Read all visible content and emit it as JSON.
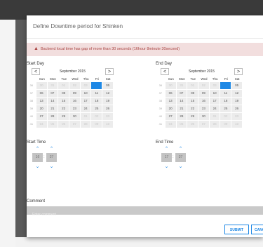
{
  "modal": {
    "title": "Define Downtime period for Shinken",
    "alert": "Backend local time has gap of more than 30 seconds (16hour 8minute 30second)",
    "alert_icon": "warning-icon"
  },
  "start_day": {
    "label": "Start Day",
    "month": "September 2015",
    "prev": "<",
    "next": ">",
    "weekdays": [
      "Sun",
      "Mon",
      "Tue",
      "Wed",
      "Thu",
      "Fri",
      "Sat"
    ],
    "weeks": [
      {
        "wk": "36",
        "days": [
          "30",
          "31",
          "01",
          "02",
          "03",
          "04",
          "05"
        ]
      },
      {
        "wk": "37",
        "days": [
          "06",
          "07",
          "08",
          "09",
          "10",
          "11",
          "12"
        ]
      },
      {
        "wk": "38",
        "days": [
          "13",
          "14",
          "15",
          "16",
          "17",
          "18",
          "19"
        ]
      },
      {
        "wk": "39",
        "days": [
          "20",
          "21",
          "22",
          "23",
          "24",
          "25",
          "26"
        ]
      },
      {
        "wk": "40",
        "days": [
          "27",
          "28",
          "29",
          "30",
          "01",
          "02",
          "03"
        ]
      },
      {
        "wk": "41",
        "days": [
          "04",
          "05",
          "06",
          "07",
          "08",
          "09",
          "10"
        ]
      }
    ]
  },
  "end_day": {
    "label": "End Day",
    "month": "September 2015",
    "prev": "<",
    "next": ">",
    "weekdays": [
      "Sun",
      "Mon",
      "Tue",
      "Wed",
      "Thu",
      "Fri",
      "Sat"
    ],
    "weeks": [
      {
        "wk": "36",
        "days": [
          "30",
          "31",
          "01",
          "02",
          "03",
          "04",
          "05"
        ]
      },
      {
        "wk": "37",
        "days": [
          "06",
          "07",
          "08",
          "09",
          "10",
          "11",
          "12"
        ]
      },
      {
        "wk": "38",
        "days": [
          "13",
          "14",
          "15",
          "16",
          "17",
          "18",
          "19"
        ]
      },
      {
        "wk": "39",
        "days": [
          "20",
          "21",
          "22",
          "23",
          "24",
          "25",
          "26"
        ]
      },
      {
        "wk": "40",
        "days": [
          "27",
          "28",
          "29",
          "30",
          "01",
          "02",
          "03"
        ]
      },
      {
        "wk": "41",
        "days": [
          "04",
          "05",
          "06",
          "07",
          "08",
          "09",
          "10"
        ]
      }
    ]
  },
  "start_time": {
    "label": "Start Time",
    "hour": "16",
    "minute": "37",
    "separator": ":"
  },
  "end_time": {
    "label": "End Time",
    "hour": "17",
    "minute": "37",
    "separator": ":"
  },
  "comment": {
    "label": "Comment",
    "placeholder": "Enter comment"
  },
  "buttons": {
    "submit": "SUBMIT",
    "cancel": "CANCEL"
  },
  "colors": {
    "accent": "#1e88e5",
    "alert_bg": "#f2dede",
    "alert_text": "#a94442"
  }
}
